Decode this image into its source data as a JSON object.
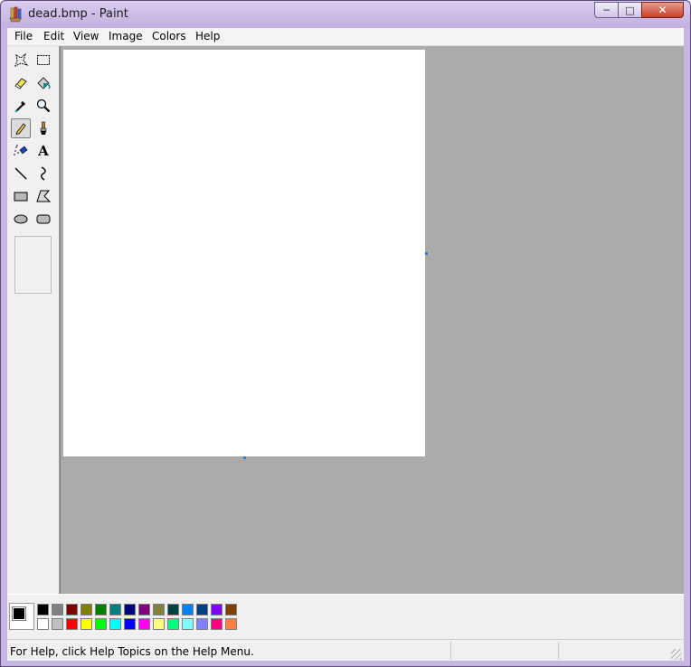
{
  "window": {
    "title": "dead.bmp - Paint",
    "controls": {
      "minimize": "─",
      "maximize": "□",
      "close": "✕"
    }
  },
  "menu": [
    "File",
    "Edit",
    "View",
    "Image",
    "Colors",
    "Help"
  ],
  "tools": [
    {
      "name": "free-form-select-icon"
    },
    {
      "name": "select-icon"
    },
    {
      "name": "eraser-icon"
    },
    {
      "name": "fill-with-color-icon"
    },
    {
      "name": "pick-color-icon"
    },
    {
      "name": "magnifier-icon"
    },
    {
      "name": "pencil-icon",
      "selected": true
    },
    {
      "name": "brush-icon"
    },
    {
      "name": "airbrush-icon"
    },
    {
      "name": "text-icon",
      "glyph": "A"
    },
    {
      "name": "line-icon"
    },
    {
      "name": "curve-icon"
    },
    {
      "name": "rectangle-icon"
    },
    {
      "name": "polygon-icon"
    },
    {
      "name": "ellipse-icon"
    },
    {
      "name": "rounded-rectangle-icon"
    }
  ],
  "colors": {
    "foreground": "#000000",
    "background": "#ffffff",
    "palette_top": [
      "#000000",
      "#808080",
      "#800000",
      "#808000",
      "#008000",
      "#008080",
      "#000080",
      "#800080",
      "#808040",
      "#004040",
      "#0080ff",
      "#004080",
      "#8000ff",
      "#804000"
    ],
    "palette_bottom": [
      "#ffffff",
      "#c0c0c0",
      "#ff0000",
      "#ffff00",
      "#00ff00",
      "#00ffff",
      "#0000ff",
      "#ff00ff",
      "#ffff80",
      "#00ff80",
      "#80ffff",
      "#8080ff",
      "#ff0080",
      "#ff8040"
    ]
  },
  "status": {
    "help_text": "For Help, click Help Topics on the Help Menu."
  }
}
